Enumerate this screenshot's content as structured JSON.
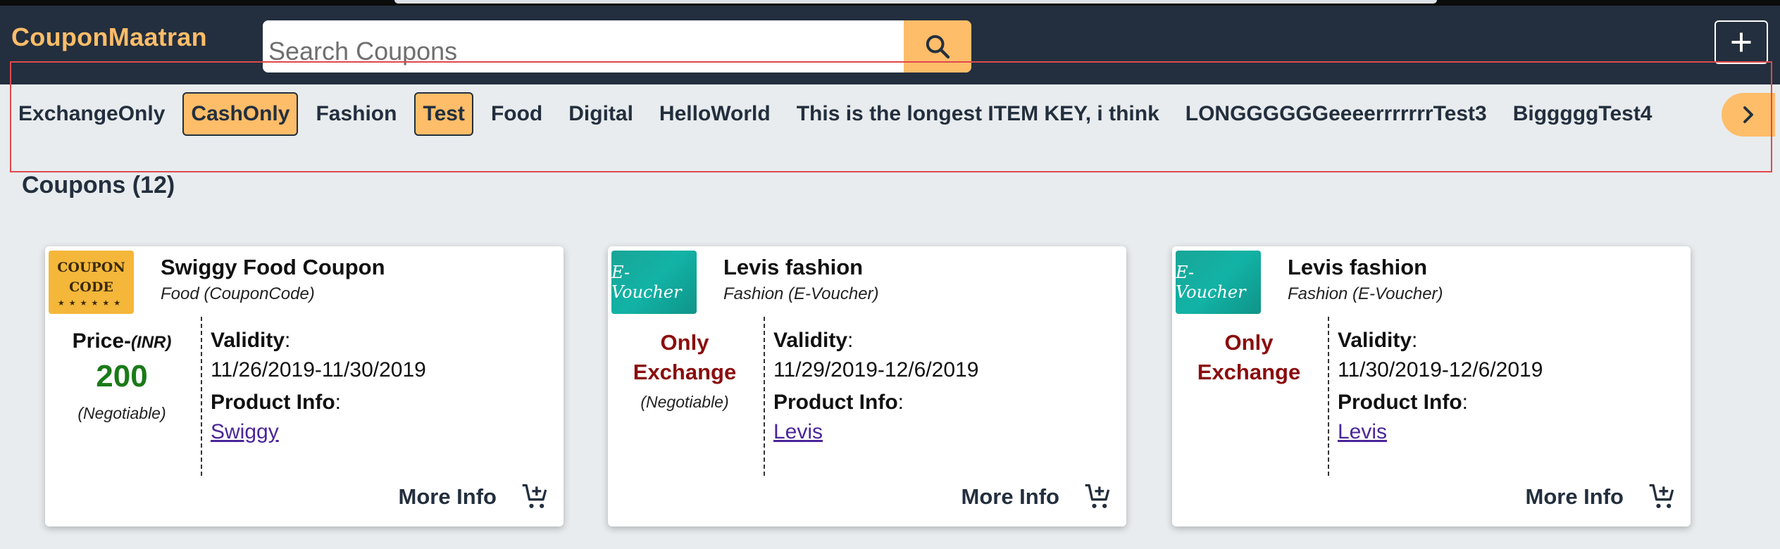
{
  "header": {
    "brand": "CouponMaatran",
    "search_placeholder": "Search Coupons",
    "search_icon": "search-icon",
    "add_icon": "plus-icon",
    "accent_color": "#febd69",
    "bg_color": "#232f3e"
  },
  "categories": {
    "items": [
      {
        "label": "ExchangeOnly",
        "active": false
      },
      {
        "label": "CashOnly",
        "active": true
      },
      {
        "label": "Fashion",
        "active": false
      },
      {
        "label": "Test",
        "active": true
      },
      {
        "label": "Food",
        "active": false
      },
      {
        "label": "Digital",
        "active": false
      },
      {
        "label": "HelloWorld",
        "active": false
      },
      {
        "label": "This is the longest ITEM KEY, i think",
        "active": false
      },
      {
        "label": "LONGGGGGGeeeerrrrrrrTest3",
        "active": false
      },
      {
        "label": "BigggggTest4",
        "active": false
      }
    ],
    "scroll_icon": "chevron-right-icon"
  },
  "coupons_heading": "Coupons (12)",
  "cards": [
    {
      "thumb": {
        "type": "coupon-code",
        "line1": "COUPON",
        "line2": "CODE"
      },
      "name": "Swiggy Food Coupon",
      "subtitle": "Food (CouponCode)",
      "price_label": "Price-",
      "price_currency": "(INR)",
      "price_value": "200",
      "exchange_line1": "",
      "exchange_line2": "",
      "negotiable": "(Negotiable)",
      "validity_label": "Validity",
      "validity_value": "11/26/2019-11/30/2019",
      "product_label": "Product Info",
      "product_link": "Swiggy",
      "more_info": "More Info"
    },
    {
      "thumb": {
        "type": "e-voucher",
        "line1": "E-Voucher"
      },
      "name": "Levis fashion",
      "subtitle": "Fashion (E-Voucher)",
      "price_label": "",
      "price_currency": "",
      "price_value": "",
      "exchange_line1": "Only",
      "exchange_line2": "Exchange",
      "negotiable": "(Negotiable)",
      "validity_label": "Validity",
      "validity_value": "11/29/2019-12/6/2019",
      "product_label": "Product Info",
      "product_link": "Levis",
      "more_info": "More Info"
    },
    {
      "thumb": {
        "type": "e-voucher",
        "line1": "E-Voucher"
      },
      "name": "Levis fashion",
      "subtitle": "Fashion (E-Voucher)",
      "price_label": "",
      "price_currency": "",
      "price_value": "",
      "exchange_line1": "Only",
      "exchange_line2": "Exchange",
      "negotiable": "",
      "validity_label": "Validity",
      "validity_value": "11/30/2019-12/6/2019",
      "product_label": "Product Info",
      "product_link": "Levis",
      "more_info": "More Info"
    }
  ],
  "colors": {
    "price_green": "#1a7a18",
    "exchange_red": "#8b0d0d",
    "link_purple": "#4b2699"
  }
}
